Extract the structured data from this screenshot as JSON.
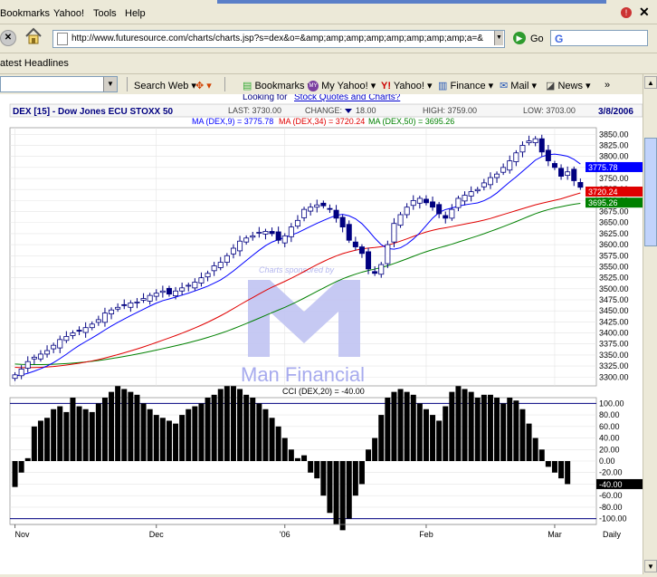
{
  "browser": {
    "menu": [
      "Bookmarks",
      "Yahoo!",
      "Tools",
      "Help"
    ],
    "url": "http://www.futuresource.com/charts/charts.jsp?s=dex&o=&amp;amp;amp;amp;amp;amp;amp;amp;a=&",
    "go_label": "Go",
    "google_glyph": "G",
    "links_label": "atest Headlines",
    "toolbar": {
      "search_web": "Search Web",
      "bookmarks": "Bookmarks",
      "my_yahoo": "My Yahoo!",
      "yahoo": "Yahoo!",
      "finance": "Finance",
      "mail": "Mail",
      "news": "News"
    }
  },
  "page": {
    "promo_link_prefix": "Looking for ",
    "promo_link": "Stock Quotes and Charts?",
    "watermark_sponsor": "Charts sponsored by",
    "watermark_brand": "Man Financial"
  },
  "header": {
    "title": "DEX [15] - Dow Jones ECU STOXX 50",
    "last": "LAST: 3730.00",
    "change_label": "CHANGE:",
    "change_value": "18.00",
    "high": "HIGH: 3759.00",
    "low": "LOW: 3703.00",
    "date": "3/8/2006"
  },
  "colors": {
    "candle": "#000080",
    "ma9": "#0000ff",
    "ma34": "#e00000",
    "ma50": "#008000",
    "cci_bar": "#000000",
    "cci_ref": "#000080",
    "header_text": "#000080",
    "watermark": "#9b9fe8"
  },
  "chart_data": [
    {
      "type": "candlestick",
      "title": "DEX [15] - Dow Jones ECU STOXX 50",
      "price_ylim": [
        3280,
        3865
      ],
      "y_ticks": [
        3300,
        3325,
        3350,
        3375,
        3400,
        3425,
        3450,
        3475,
        3500,
        3525,
        3550,
        3575,
        3600,
        3625,
        3650,
        3675,
        3700,
        3725,
        3750,
        3775,
        3800,
        3825,
        3850
      ],
      "x_labels": [
        "Nov",
        "Dec",
        "'06",
        "Feb",
        "Mar",
        "Daily"
      ],
      "x_label_index": [
        0,
        22,
        42,
        64,
        84
      ],
      "legend": [
        {
          "name": "MA (DEX,9)",
          "value": "3775.78"
        },
        {
          "name": "MA (DEX,34)",
          "value": "3720.24"
        },
        {
          "name": "MA (DEX,50)",
          "value": "3695.26"
        }
      ],
      "last_price": "3730.00",
      "closes": [
        3305,
        3318,
        3335,
        3345,
        3352,
        3360,
        3372,
        3385,
        3392,
        3400,
        3405,
        3412,
        3420,
        3430,
        3445,
        3452,
        3458,
        3462,
        3468,
        3470,
        3478,
        3485,
        3490,
        3495,
        3488,
        3495,
        3502,
        3508,
        3515,
        3525,
        3535,
        3552,
        3560,
        3575,
        3592,
        3608,
        3615,
        3620,
        3628,
        3630,
        3625,
        3610,
        3620,
        3640,
        3655,
        3680,
        3685,
        3690,
        3688,
        3680,
        3660,
        3640,
        3610,
        3595,
        3580,
        3545,
        3535,
        3555,
        3600,
        3648,
        3668,
        3685,
        3700,
        3705,
        3695,
        3685,
        3670,
        3660,
        3680,
        3705,
        3712,
        3720,
        3725,
        3740,
        3752,
        3760,
        3775,
        3790,
        3808,
        3825,
        3835,
        3840,
        3810,
        3790,
        3775,
        3755,
        3765,
        3745,
        3730
      ],
      "ma9_last": 3775.78,
      "ma34_last": 3720.24,
      "ma50_last": 3695.26
    },
    {
      "type": "bar",
      "title": "CCI (DEX,20) = -40.00",
      "ylim": [
        -110,
        110
      ],
      "y_ticks": [
        100,
        80,
        60,
        40,
        20,
        0,
        -20,
        -40,
        -60,
        -80,
        -100
      ],
      "reference_lines": [
        100,
        -100
      ],
      "last_value": "-40.00",
      "values": [
        -45,
        -20,
        5,
        60,
        70,
        75,
        90,
        95,
        85,
        110,
        95,
        90,
        85,
        100,
        110,
        120,
        130,
        125,
        120,
        115,
        100,
        90,
        80,
        75,
        70,
        65,
        80,
        90,
        95,
        100,
        110,
        115,
        125,
        130,
        130,
        125,
        115,
        110,
        100,
        90,
        75,
        60,
        40,
        20,
        5,
        10,
        -20,
        -30,
        -60,
        -90,
        -110,
        -120,
        -100,
        -60,
        -40,
        20,
        40,
        80,
        110,
        120,
        125,
        120,
        115,
        100,
        90,
        80,
        70,
        95,
        120,
        130,
        125,
        120,
        110,
        115,
        115,
        110,
        100,
        110,
        105,
        90,
        65,
        40,
        20,
        -10,
        -20,
        -30,
        -40
      ]
    }
  ]
}
